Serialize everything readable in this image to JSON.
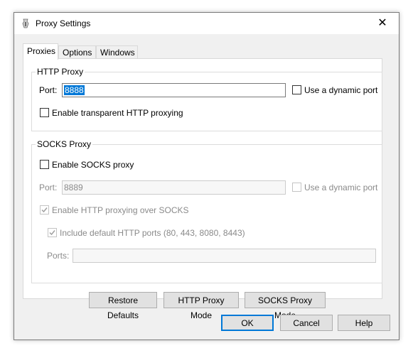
{
  "window": {
    "title": "Proxy Settings",
    "close_glyph": "✕"
  },
  "tabs": [
    {
      "label": "Proxies",
      "active": true
    },
    {
      "label": "Options",
      "active": false
    },
    {
      "label": "Windows",
      "active": false
    }
  ],
  "http_proxy": {
    "group_title": "HTTP Proxy",
    "port_label": "Port:",
    "port_value": "8888",
    "dynamic_port_label": "Use a dynamic port",
    "dynamic_port_checked": false,
    "transparent_label": "Enable transparent HTTP proxying",
    "transparent_checked": false
  },
  "socks_proxy": {
    "group_title": "SOCKS Proxy",
    "enable_label": "Enable SOCKS proxy",
    "enable_checked": false,
    "port_label": "Port:",
    "port_value": "8889",
    "dynamic_port_label": "Use a dynamic port",
    "http_over_socks_label": "Enable HTTP proxying over SOCKS",
    "http_over_socks_checked": true,
    "include_default_ports_label": "Include default HTTP ports (80, 443, 8080, 8443)",
    "include_default_ports_checked": true,
    "ports_label": "Ports:",
    "ports_value": ""
  },
  "mode_buttons": {
    "restore": "Restore Defaults",
    "http_mode": "HTTP Proxy Mode",
    "socks_mode": "SOCKS Proxy Mode"
  },
  "dialog_buttons": {
    "ok": "OK",
    "cancel": "Cancel",
    "help": "Help"
  },
  "icons": {
    "app": "fiddler-icon",
    "close": "close-icon",
    "check": "checkmark-icon"
  },
  "colors": {
    "selection": "#0078d7",
    "default_button_border": "#0078d7",
    "disabled_text": "#8a8a8a"
  }
}
